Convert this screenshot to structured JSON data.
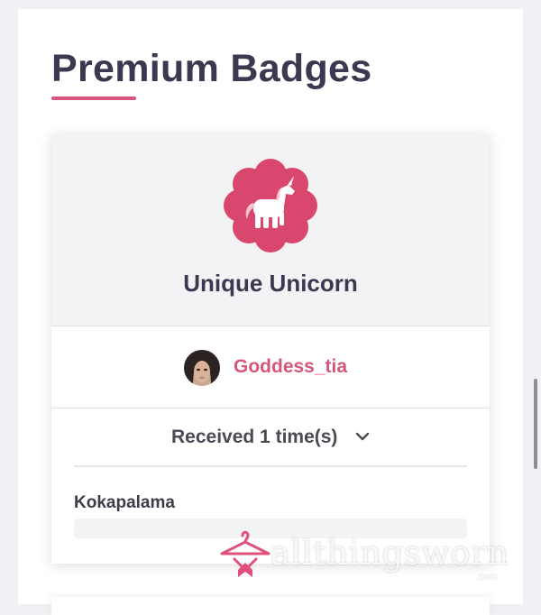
{
  "page": {
    "title": "Premium Badges"
  },
  "badge": {
    "name": "Unique Unicorn",
    "icon": "unicorn-icon",
    "icon_color": "#d9476e"
  },
  "seller": {
    "name": "Goddess_tia",
    "name_color": "#d6577a"
  },
  "received": {
    "label": "Received 1 time(s)",
    "icon": "chevron-down-icon"
  },
  "recipients": [
    {
      "name": "Kokapalama"
    }
  ],
  "watermark": {
    "text": "allthingsworn",
    "sub": ".com",
    "icon": "hanger-bow-icon"
  },
  "colors": {
    "accent": "#d6577a",
    "title": "#3a3950",
    "background": "#f0f1f4"
  }
}
